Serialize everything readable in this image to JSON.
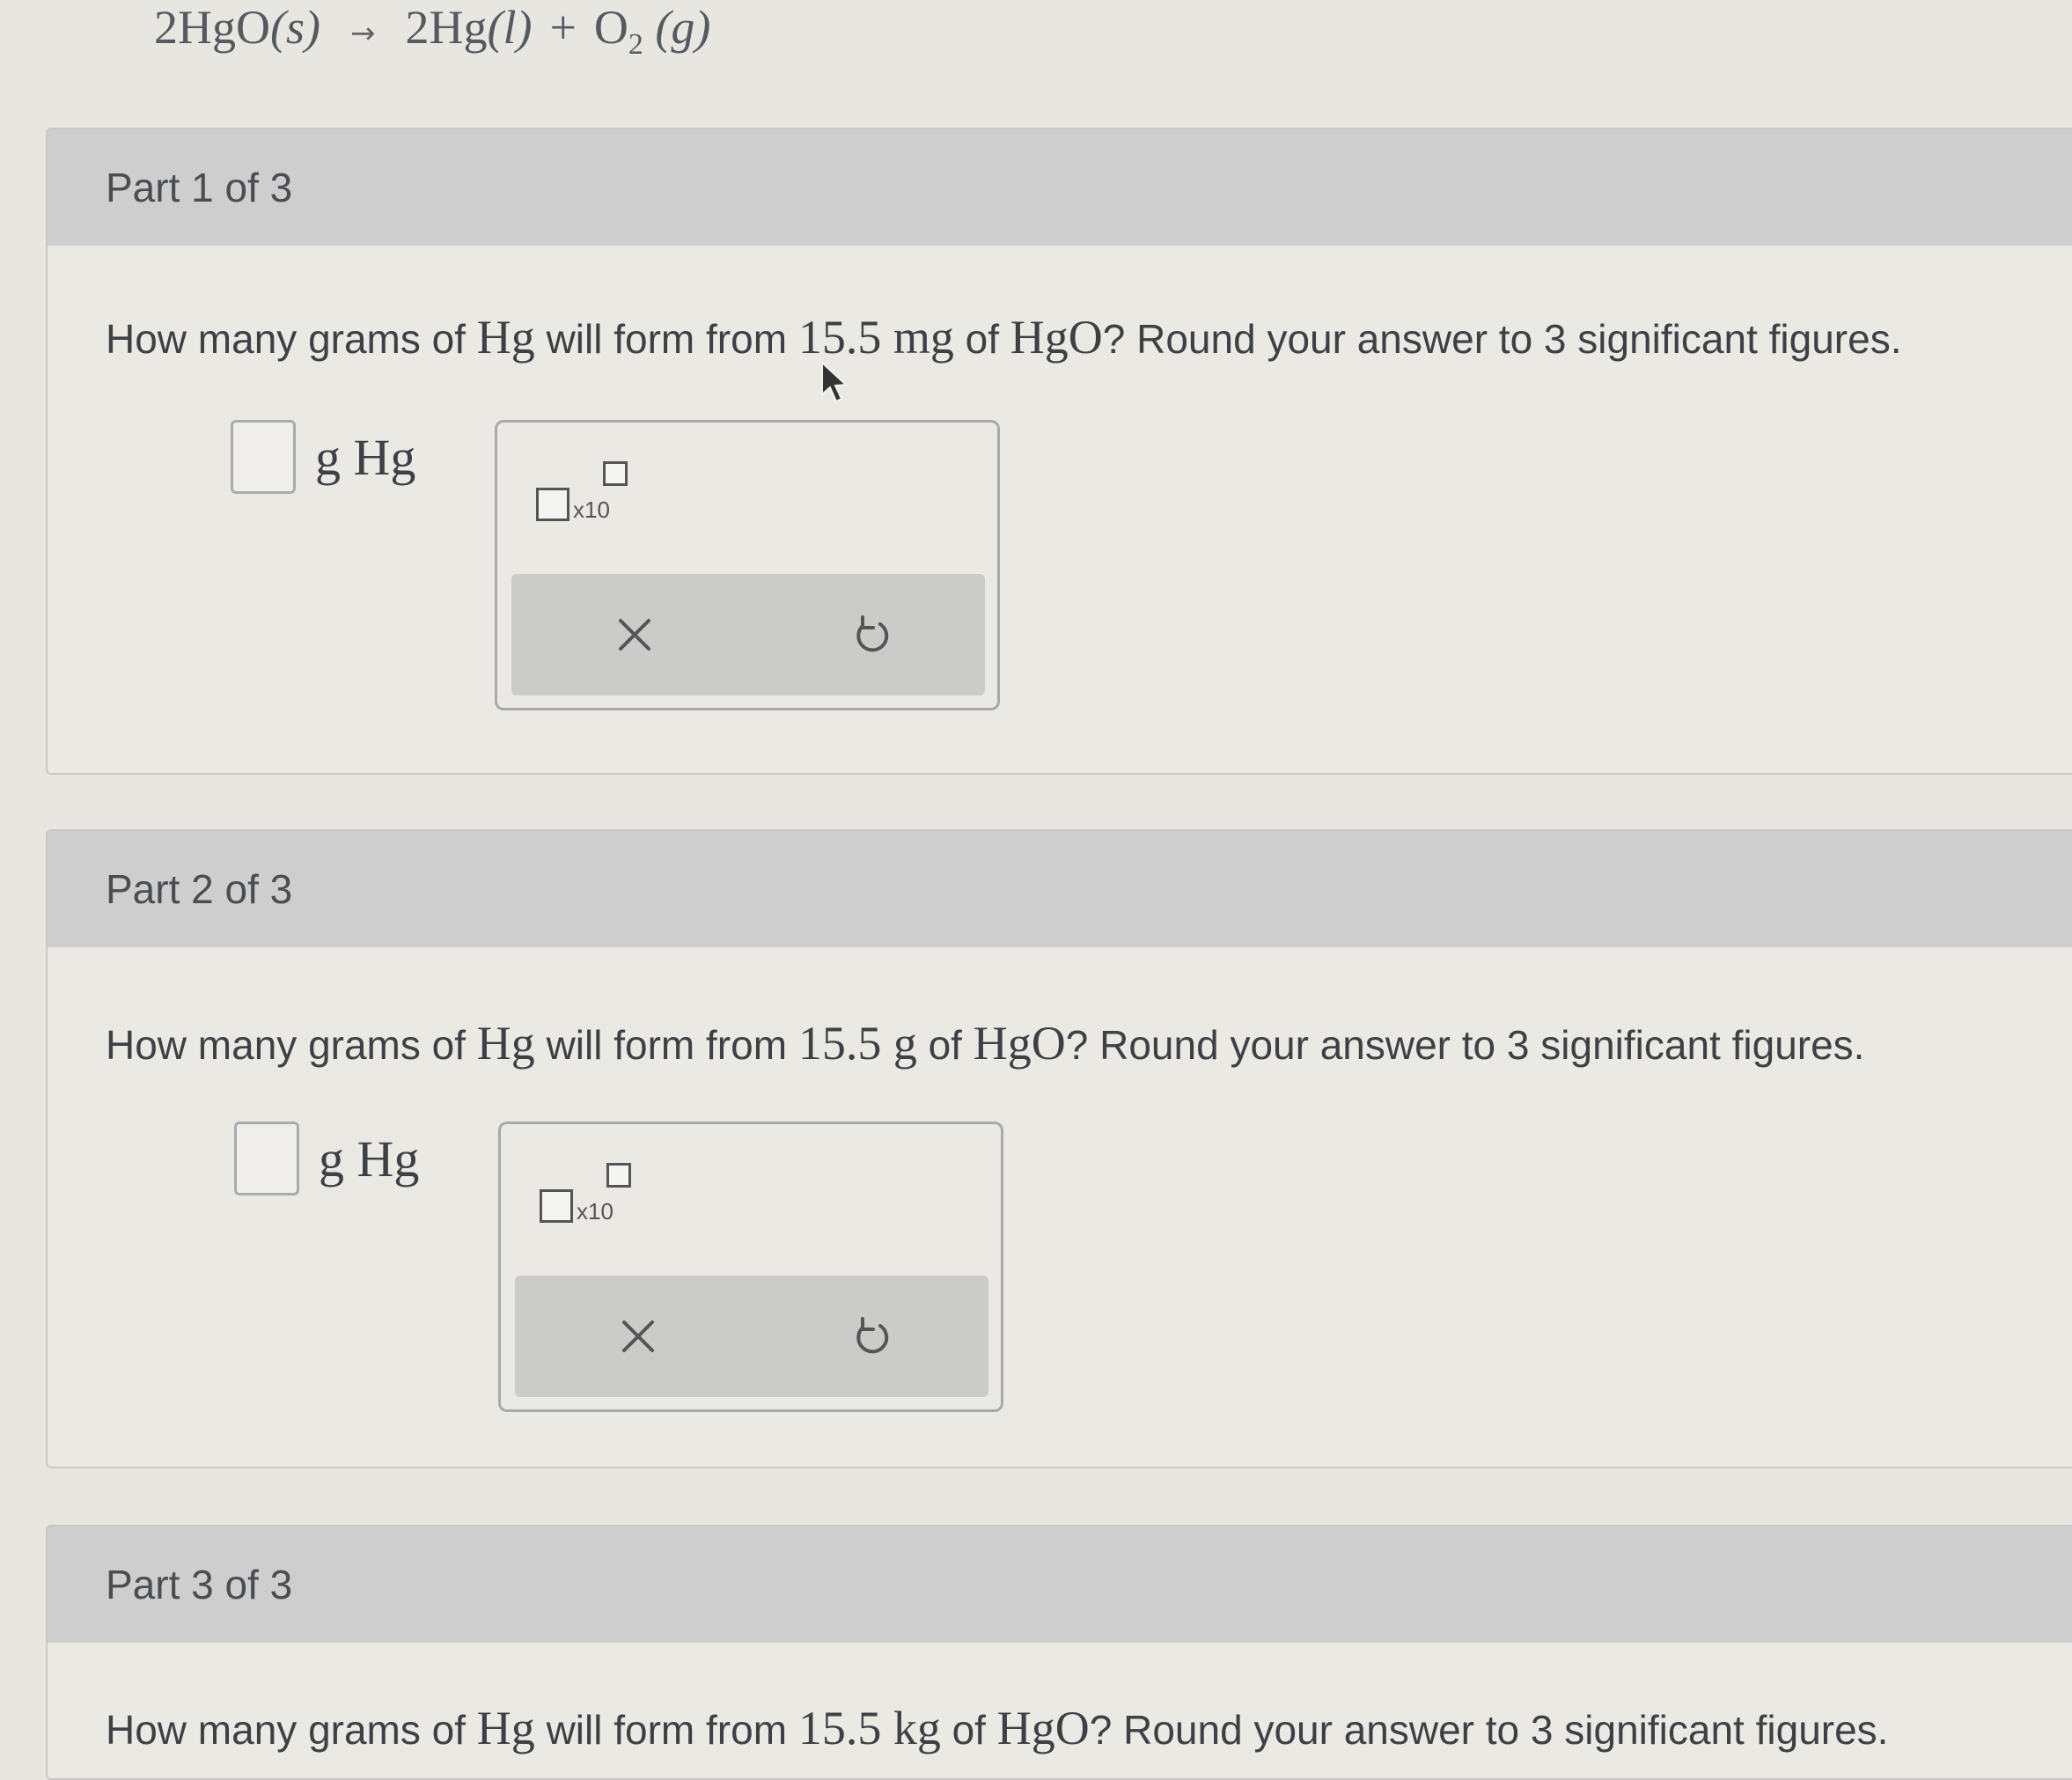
{
  "equation": {
    "reactant": "2HgO",
    "reactant_state": "(s)",
    "arrow": "→",
    "product1": "2Hg",
    "product1_state": "(l)",
    "plus": "+",
    "product2": "O",
    "product2_sub": "2",
    "product2_state": "(g)"
  },
  "parts": [
    {
      "header": "Part 1 of 3",
      "q_pre": "How many grams of",
      "q_species": "Hg",
      "q_mid": "will form from",
      "q_amount": "15.5 mg",
      "q_of": "of",
      "q_reactant": "HgO",
      "q_post": "? Round your answer to 3 significant figures.",
      "answer_value": "",
      "unit": "g Hg",
      "x10_label": "x10"
    },
    {
      "header": "Part 2 of 3",
      "q_pre": "How many grams of",
      "q_species": "Hg",
      "q_mid": "will form from",
      "q_amount": "15.5 g",
      "q_of": "of",
      "q_reactant": "HgO",
      "q_post": "? Round your answer to 3 significant figures.",
      "answer_value": "",
      "unit": "g Hg",
      "x10_label": "x10"
    },
    {
      "header": "Part 3 of 3",
      "q_pre": "How many grams of",
      "q_species": "Hg",
      "q_mid": "will form from",
      "q_amount": "15.5 kg",
      "q_of": "of",
      "q_reactant": "HgO",
      "q_post": "? Round your answer to 3 significant figures."
    }
  ],
  "icons": {
    "clear": "close-icon",
    "undo": "undo-icon",
    "pointer": "mouse-pointer-icon"
  }
}
